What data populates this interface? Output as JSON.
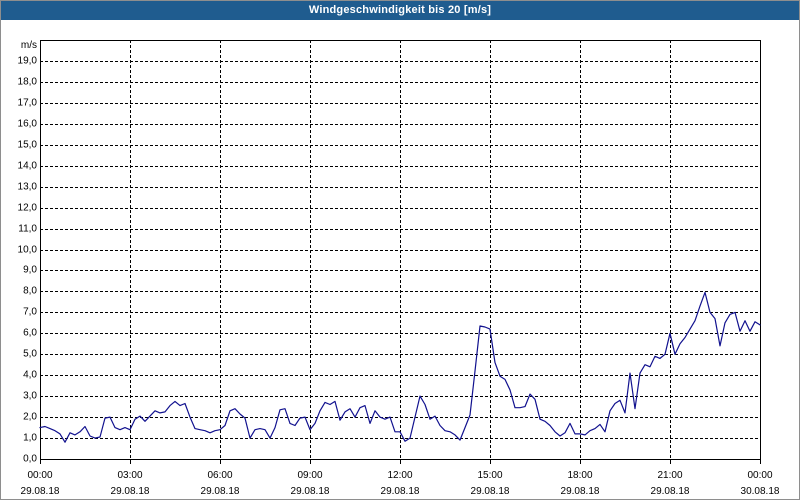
{
  "colors": {
    "title_bar": "#1f5c8f",
    "title_text": "#ffffff",
    "grid": "#000000",
    "frame": "#000000"
  },
  "chart_data": {
    "type": "line",
    "title": "Windgeschwindigkeit bis 20 [m/s]",
    "xlabel": "",
    "ylabel": "m/s",
    "xlim": [
      "29.08.18 00:00",
      "30.08.18 00:00"
    ],
    "ylim": [
      0,
      20
    ],
    "grid": true,
    "legend": "none",
    "y_ticks": [
      {
        "value": 0,
        "label": "0,0"
      },
      {
        "value": 1,
        "label": "1,0"
      },
      {
        "value": 2,
        "label": "2,0"
      },
      {
        "value": 3,
        "label": "3,0"
      },
      {
        "value": 4,
        "label": "4,0"
      },
      {
        "value": 5,
        "label": "5,0"
      },
      {
        "value": 6,
        "label": "6,0"
      },
      {
        "value": 7,
        "label": "7,0"
      },
      {
        "value": 8,
        "label": "8,0"
      },
      {
        "value": 9,
        "label": "9,0"
      },
      {
        "value": 10,
        "label": "10,0"
      },
      {
        "value": 11,
        "label": "11,0"
      },
      {
        "value": 12,
        "label": "12,0"
      },
      {
        "value": 13,
        "label": "13,0"
      },
      {
        "value": 14,
        "label": "14,0"
      },
      {
        "value": 15,
        "label": "15,0"
      },
      {
        "value": 16,
        "label": "16,0"
      },
      {
        "value": 17,
        "label": "17,0"
      },
      {
        "value": 18,
        "label": "18,0"
      },
      {
        "value": 19,
        "label": "19,0"
      }
    ],
    "x_ticks": [
      {
        "time": "00:00",
        "date": "29.08.18"
      },
      {
        "time": "03:00",
        "date": "29.08.18"
      },
      {
        "time": "06:00",
        "date": "29.08.18"
      },
      {
        "time": "09:00",
        "date": "29.08.18"
      },
      {
        "time": "12:00",
        "date": "29.08.18"
      },
      {
        "time": "15:00",
        "date": "29.08.18"
      },
      {
        "time": "18:00",
        "date": "29.08.18"
      },
      {
        "time": "21:00",
        "date": "29.08.18"
      },
      {
        "time": "00:00",
        "date": "30.08.18"
      }
    ],
    "series": [
      {
        "color": "#12128f",
        "points": [
          [
            "29.08.18 00:00",
            1.5
          ],
          [
            "29.08.18 00:10",
            1.55
          ],
          [
            "29.08.18 00:20",
            1.45
          ],
          [
            "29.08.18 00:30",
            1.35
          ],
          [
            "29.08.18 00:40",
            1.2
          ],
          [
            "29.08.18 00:50",
            0.8
          ],
          [
            "29.08.18 01:00",
            1.25
          ],
          [
            "29.08.18 01:10",
            1.15
          ],
          [
            "29.08.18 01:20",
            1.3
          ],
          [
            "29.08.18 01:30",
            1.55
          ],
          [
            "29.08.18 01:40",
            1.1
          ],
          [
            "29.08.18 01:50",
            1.0
          ],
          [
            "29.08.18 02:00",
            1.05
          ],
          [
            "29.08.18 02:10",
            1.95
          ],
          [
            "29.08.18 02:20",
            2.0
          ],
          [
            "29.08.18 02:30",
            1.5
          ],
          [
            "29.08.18 02:40",
            1.4
          ],
          [
            "29.08.18 02:50",
            1.5
          ],
          [
            "29.08.18 03:00",
            1.4
          ],
          [
            "29.08.18 03:10",
            1.9
          ],
          [
            "29.08.18 03:20",
            2.05
          ],
          [
            "29.08.18 03:30",
            1.8
          ],
          [
            "29.08.18 03:40",
            2.05
          ],
          [
            "29.08.18 03:50",
            2.3
          ],
          [
            "29.08.18 04:00",
            2.2
          ],
          [
            "29.08.18 04:10",
            2.25
          ],
          [
            "29.08.18 04:20",
            2.55
          ],
          [
            "29.08.18 04:30",
            2.75
          ],
          [
            "29.08.18 04:40",
            2.55
          ],
          [
            "29.08.18 04:50",
            2.65
          ],
          [
            "29.08.18 05:00",
            2.0
          ],
          [
            "29.08.18 05:10",
            1.45
          ],
          [
            "29.08.18 05:20",
            1.4
          ],
          [
            "29.08.18 05:30",
            1.35
          ],
          [
            "29.08.18 05:40",
            1.25
          ],
          [
            "29.08.18 05:50",
            1.35
          ],
          [
            "29.08.18 06:00",
            1.4
          ],
          [
            "29.08.18 06:10",
            1.6
          ],
          [
            "29.08.18 06:20",
            2.3
          ],
          [
            "29.08.18 06:30",
            2.4
          ],
          [
            "29.08.18 06:40",
            2.15
          ],
          [
            "29.08.18 06:50",
            1.95
          ],
          [
            "29.08.18 07:00",
            1.0
          ],
          [
            "29.08.18 07:10",
            1.4
          ],
          [
            "29.08.18 07:20",
            1.45
          ],
          [
            "29.08.18 07:30",
            1.4
          ],
          [
            "29.08.18 07:40",
            1.0
          ],
          [
            "29.08.18 07:50",
            1.5
          ],
          [
            "29.08.18 08:00",
            2.35
          ],
          [
            "29.08.18 08:10",
            2.4
          ],
          [
            "29.08.18 08:20",
            1.7
          ],
          [
            "29.08.18 08:30",
            1.6
          ],
          [
            "29.08.18 08:40",
            1.95
          ],
          [
            "29.08.18 08:50",
            2.0
          ],
          [
            "29.08.18 09:00",
            1.4
          ],
          [
            "29.08.18 09:10",
            1.7
          ],
          [
            "29.08.18 09:20",
            2.3
          ],
          [
            "29.08.18 09:30",
            2.7
          ],
          [
            "29.08.18 09:40",
            2.6
          ],
          [
            "29.08.18 09:50",
            2.75
          ],
          [
            "29.08.18 10:00",
            1.85
          ],
          [
            "29.08.18 10:10",
            2.25
          ],
          [
            "29.08.18 10:20",
            2.4
          ],
          [
            "29.08.18 10:30",
            2.0
          ],
          [
            "29.08.18 10:40",
            2.45
          ],
          [
            "29.08.18 10:50",
            2.55
          ],
          [
            "29.08.18 11:00",
            1.7
          ],
          [
            "29.08.18 11:10",
            2.3
          ],
          [
            "29.08.18 11:20",
            2.0
          ],
          [
            "29.08.18 11:30",
            1.9
          ],
          [
            "29.08.18 11:40",
            2.0
          ],
          [
            "29.08.18 11:50",
            1.3
          ],
          [
            "29.08.18 12:00",
            1.3
          ],
          [
            "29.08.18 12:10",
            0.85
          ],
          [
            "29.08.18 12:20",
            1.0
          ],
          [
            "29.08.18 12:30",
            2.0
          ],
          [
            "29.08.18 12:40",
            3.0
          ],
          [
            "29.08.18 12:50",
            2.6
          ],
          [
            "29.08.18 13:00",
            1.9
          ],
          [
            "29.08.18 13:10",
            2.05
          ],
          [
            "29.08.18 13:20",
            1.6
          ],
          [
            "29.08.18 13:30",
            1.35
          ],
          [
            "29.08.18 13:40",
            1.3
          ],
          [
            "29.08.18 13:50",
            1.15
          ],
          [
            "29.08.18 14:00",
            0.9
          ],
          [
            "29.08.18 14:10",
            1.5
          ],
          [
            "29.08.18 14:20",
            2.1
          ],
          [
            "29.08.18 14:30",
            4.2
          ],
          [
            "29.08.18 14:40",
            6.35
          ],
          [
            "29.08.18 14:50",
            6.3
          ],
          [
            "29.08.18 15:00",
            6.2
          ],
          [
            "29.08.18 15:10",
            4.6
          ],
          [
            "29.08.18 15:20",
            3.95
          ],
          [
            "29.08.18 15:30",
            3.8
          ],
          [
            "29.08.18 15:40",
            3.3
          ],
          [
            "29.08.18 15:50",
            2.45
          ],
          [
            "29.08.18 16:00",
            2.45
          ],
          [
            "29.08.18 16:10",
            2.5
          ],
          [
            "29.08.18 16:20",
            3.1
          ],
          [
            "29.08.18 16:30",
            2.85
          ],
          [
            "29.08.18 16:40",
            1.9
          ],
          [
            "29.08.18 16:50",
            1.8
          ],
          [
            "29.08.18 17:00",
            1.6
          ],
          [
            "29.08.18 17:10",
            1.3
          ],
          [
            "29.08.18 17:20",
            1.1
          ],
          [
            "29.08.18 17:30",
            1.25
          ],
          [
            "29.08.18 17:40",
            1.7
          ],
          [
            "29.08.18 17:50",
            1.2
          ],
          [
            "29.08.18 18:00",
            1.2
          ],
          [
            "29.08.18 18:10",
            1.15
          ],
          [
            "29.08.18 18:20",
            1.35
          ],
          [
            "29.08.18 18:30",
            1.45
          ],
          [
            "29.08.18 18:40",
            1.65
          ],
          [
            "29.08.18 18:50",
            1.3
          ],
          [
            "29.08.18 19:00",
            2.3
          ],
          [
            "29.08.18 19:10",
            2.65
          ],
          [
            "29.08.18 19:20",
            2.8
          ],
          [
            "29.08.18 19:30",
            2.2
          ],
          [
            "29.08.18 19:40",
            4.1
          ],
          [
            "29.08.18 19:50",
            2.4
          ],
          [
            "29.08.18 20:00",
            4.1
          ],
          [
            "29.08.18 20:10",
            4.5
          ],
          [
            "29.08.18 20:20",
            4.4
          ],
          [
            "29.08.18 20:30",
            4.9
          ],
          [
            "29.08.18 20:40",
            4.8
          ],
          [
            "29.08.18 20:50",
            5.0
          ],
          [
            "29.08.18 21:00",
            6.0
          ],
          [
            "29.08.18 21:10",
            5.0
          ],
          [
            "29.08.18 21:20",
            5.5
          ],
          [
            "29.08.18 21:30",
            5.8
          ],
          [
            "29.08.18 21:40",
            6.2
          ],
          [
            "29.08.18 21:50",
            6.6
          ],
          [
            "29.08.18 22:00",
            7.3
          ],
          [
            "29.08.18 22:10",
            7.95
          ],
          [
            "29.08.18 22:20",
            7.0
          ],
          [
            "29.08.18 22:30",
            6.7
          ],
          [
            "29.08.18 22:40",
            5.4
          ],
          [
            "29.08.18 22:50",
            6.5
          ],
          [
            "29.08.18 23:00",
            6.9
          ],
          [
            "29.08.18 23:10",
            7.0
          ],
          [
            "29.08.18 23:20",
            6.1
          ],
          [
            "29.08.18 23:30",
            6.6
          ],
          [
            "29.08.18 23:40",
            6.1
          ],
          [
            "29.08.18 23:50",
            6.55
          ],
          [
            "30.08.18 00:00",
            6.4
          ]
        ]
      }
    ]
  }
}
